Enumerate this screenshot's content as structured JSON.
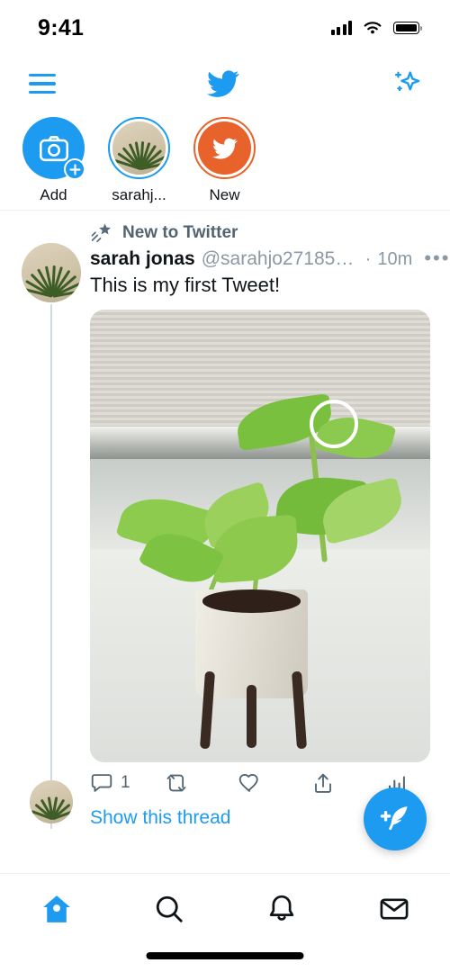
{
  "status_bar": {
    "time": "9:41",
    "signal_icon": "cellular-signal-icon",
    "wifi_icon": "wifi-icon",
    "battery_icon": "battery-full-icon"
  },
  "header": {
    "menu_icon": "hamburger-menu-icon",
    "logo_icon": "twitter-bird-logo",
    "sparkle_icon": "sparkle-icon",
    "accent_color": "#1d9bf0"
  },
  "fleets": {
    "items": [
      {
        "label": "Add",
        "type": "add",
        "icon": "camera-icon",
        "badge_icon": "plus-icon",
        "ring_color": ""
      },
      {
        "label": "sarahj...",
        "type": "avatar",
        "icon": "user-avatar",
        "ring_color": "#1d9bf0"
      },
      {
        "label": "New",
        "type": "new",
        "icon": "twitter-bird-icon",
        "ring_color": "#e8622c"
      }
    ]
  },
  "timeline": {
    "tweet": {
      "social_context": "New to Twitter",
      "social_context_icon": "shooting-star-icon",
      "display_name": "sarah jonas",
      "handle": "@sarahjo271859…",
      "timestamp_separator": "·",
      "timestamp": "10m",
      "more_icon": "more-options-icon",
      "text": "This is my first Tweet!",
      "media_alt": "potted pothos plant on a windowsill",
      "cursor_indicator": "touch-ring-cursor",
      "actions": [
        {
          "name": "reply",
          "icon": "reply-icon",
          "count": "1"
        },
        {
          "name": "retweet",
          "icon": "retweet-icon",
          "count": ""
        },
        {
          "name": "like",
          "icon": "heart-icon",
          "count": ""
        },
        {
          "name": "share",
          "icon": "share-icon",
          "count": ""
        },
        {
          "name": "analytics",
          "icon": "analytics-bar-icon",
          "count": ""
        }
      ],
      "show_thread_label": "Show this thread",
      "link_color": "#1d9bf0"
    }
  },
  "compose_fab": {
    "icon": "compose-feather-plus-icon",
    "color": "#1d9bf0"
  },
  "bottom_nav": {
    "items": [
      {
        "name": "home",
        "icon": "home-icon",
        "active": true
      },
      {
        "name": "search",
        "icon": "search-icon",
        "active": false
      },
      {
        "name": "notifications",
        "icon": "bell-icon",
        "active": false
      },
      {
        "name": "messages",
        "icon": "envelope-icon",
        "active": false
      }
    ],
    "active_color": "#1d9bf0",
    "inactive_color": "#0f1419",
    "home_indicator": "home-indicator-bar"
  }
}
